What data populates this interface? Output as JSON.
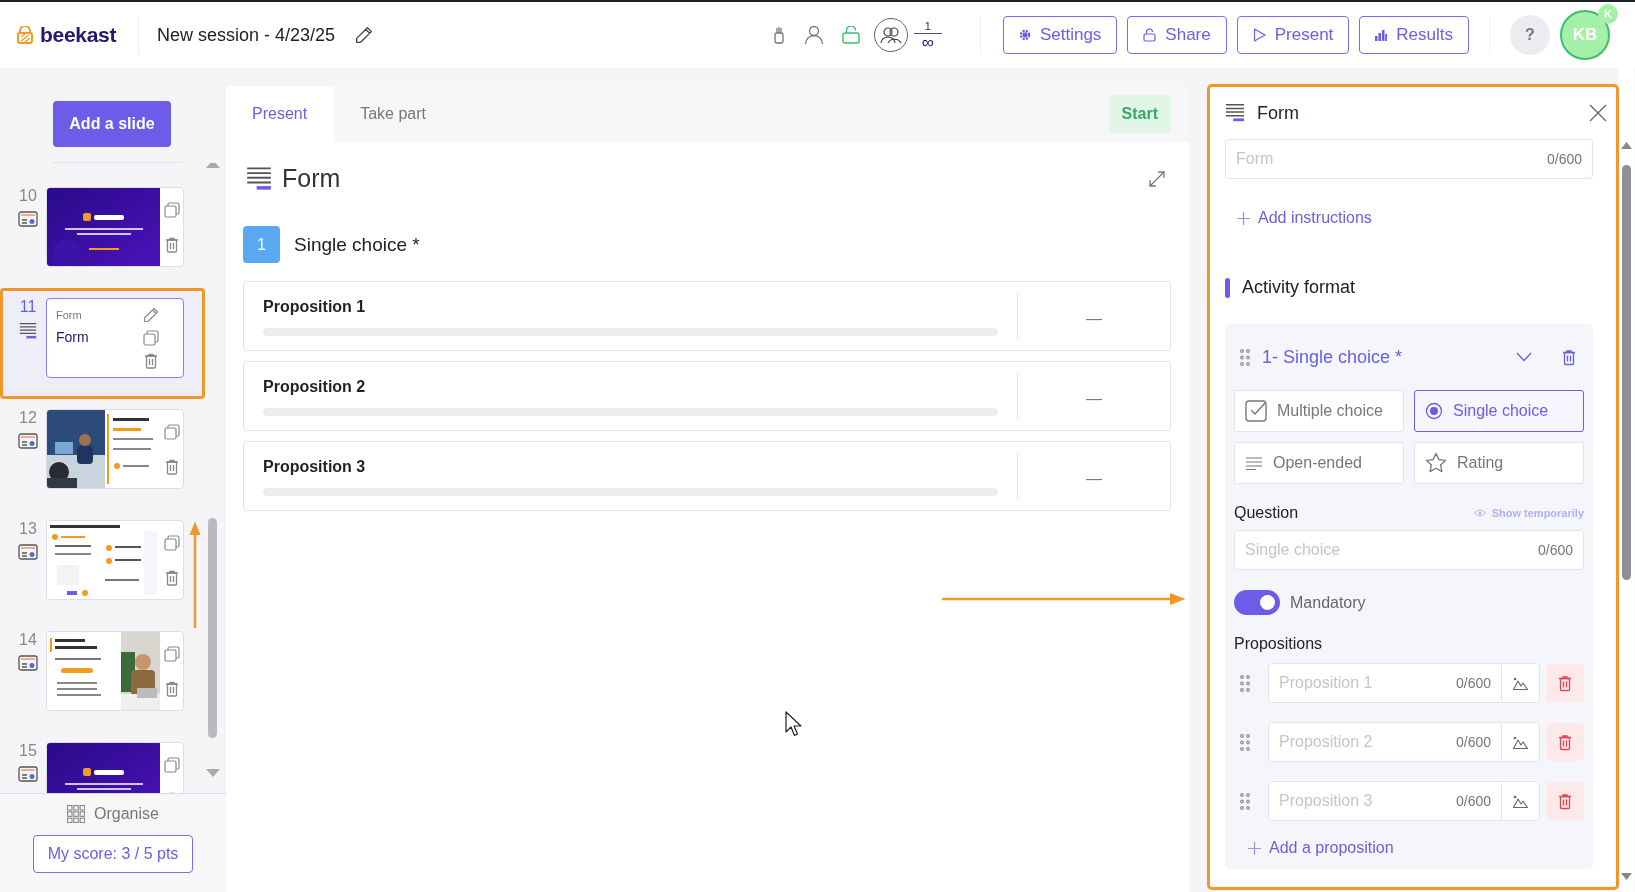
{
  "header": {
    "logo": "beekast",
    "session_title": "New session - 4/23/25",
    "participants": {
      "count": "1",
      "limit": "∞"
    },
    "buttons": [
      {
        "label": "Settings",
        "kind": "settings"
      },
      {
        "label": "Share",
        "kind": "share"
      },
      {
        "label": "Present",
        "kind": "present"
      },
      {
        "label": "Results",
        "kind": "results"
      }
    ],
    "help": "?",
    "avatar": {
      "initials": "KB",
      "badge": "K"
    }
  },
  "sidebar": {
    "add_button": "Add a slide",
    "slides": [
      {
        "number": "10",
        "kind": "picture",
        "selected": false
      },
      {
        "number": "11",
        "kind": "form",
        "selected": true,
        "caption": "Form",
        "title": "Form"
      },
      {
        "number": "12",
        "kind": "picture",
        "selected": false
      },
      {
        "number": "13",
        "kind": "picture",
        "selected": false
      },
      {
        "number": "14",
        "kind": "picture",
        "selected": false
      },
      {
        "number": "15",
        "kind": "picture",
        "selected": false
      }
    ],
    "organise": "Organise",
    "score": "My score: 3 / 5 pts"
  },
  "center": {
    "tabs": [
      {
        "label": "Present",
        "selected": true
      },
      {
        "label": "Take part",
        "selected": false
      }
    ],
    "start_button": "Start",
    "title": "Form",
    "question": {
      "number": "1",
      "title": "Single choice *"
    },
    "propositions": [
      {
        "label": "Proposition 1",
        "result": "—"
      },
      {
        "label": "Proposition 2",
        "result": "—"
      },
      {
        "label": "Proposition 3",
        "result": "—"
      }
    ]
  },
  "panel": {
    "title": "Form",
    "title_field": {
      "placeholder": "Form",
      "counter": "0/600"
    },
    "add_instructions": "Add instructions",
    "section": "Activity format",
    "question_card": {
      "title": "1- Single choice *",
      "types": [
        {
          "label": "Multiple choice",
          "kind": "multiple",
          "selected": false
        },
        {
          "label": "Single choice",
          "kind": "single",
          "selected": true
        },
        {
          "label": "Open-ended",
          "kind": "open",
          "selected": false
        },
        {
          "label": "Rating",
          "kind": "rating",
          "selected": false
        }
      ],
      "question_label": "Question",
      "show_temporarily": "Show temporarily",
      "question_field": {
        "placeholder": "Single choice",
        "counter": "0/600"
      },
      "mandatory": {
        "label": "Mandatory",
        "on": true
      },
      "propositions_label": "Propositions",
      "propositions": [
        {
          "placeholder": "Proposition 1",
          "counter": "0/600"
        },
        {
          "placeholder": "Proposition 2",
          "counter": "0/600"
        },
        {
          "placeholder": "Proposition 3",
          "counter": "0/600"
        }
      ],
      "add_proposition": "Add a proposition"
    }
  }
}
